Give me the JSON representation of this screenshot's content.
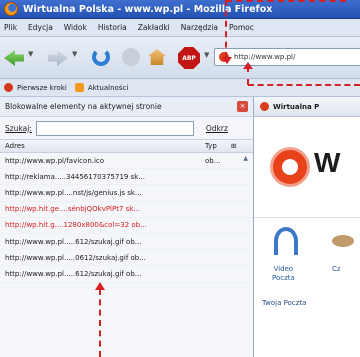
{
  "window": {
    "title": "Wirtualna Polska - www.wp.pl - Mozilla Firefox"
  },
  "menu": {
    "items": [
      "Plik",
      "Edycja",
      "Widok",
      "Historia",
      "Zakładki",
      "Narzędzia",
      "Pomoc"
    ]
  },
  "toolbar": {
    "abp_label": "ABP",
    "dropdown_glyph": "▼",
    "url": "http://www.wp.pl/"
  },
  "bookmarks": {
    "items": [
      "Pierwsze kroki",
      "Aktualności"
    ]
  },
  "sidebar": {
    "title": "Blokowalne elementy na aktywnej stronie",
    "close_glyph": "×",
    "search_label": "Szukaj:",
    "search_value": "",
    "clear_label": "Odkrz",
    "columns": {
      "address": "Adres",
      "type": "Typ",
      "filter": "⊞"
    },
    "rows": [
      {
        "address": "http://www.wp.pl/favicon.ico",
        "type": "ob...",
        "blocked": false
      },
      {
        "address": "http://reklama.....34456170375719 sk...",
        "type": "",
        "blocked": false
      },
      {
        "address": "http://www.wp.pl....nst/js/genius.js sk...",
        "type": "",
        "blocked": false
      },
      {
        "address": "http://wp.hit.ge....sénbjQOkvPlPt7 sk...",
        "type": "",
        "blocked": true
      },
      {
        "address": "http://wp.hit.g....1280x800&col=32 ob...",
        "type": "",
        "blocked": true
      },
      {
        "address": "http://www.wp.pl.....612/szukaj.gif ob...",
        "type": "",
        "blocked": false
      },
      {
        "address": "http://www.wp.pl.....0612/szukaj.gif ob...",
        "type": "",
        "blocked": false
      },
      {
        "address": "http://www.wp.pl.....612/szukaj.gif ob...",
        "type": "",
        "blocked": false
      }
    ]
  },
  "content": {
    "tab_label": "Wirtualna P",
    "logo_text": "W",
    "video_label": "Video\nPoczta",
    "cz_label": "Cz",
    "twoja_label": "Twoja Poczta"
  },
  "colors": {
    "blocked_row": "#d32020",
    "annotation": "#d42020"
  }
}
